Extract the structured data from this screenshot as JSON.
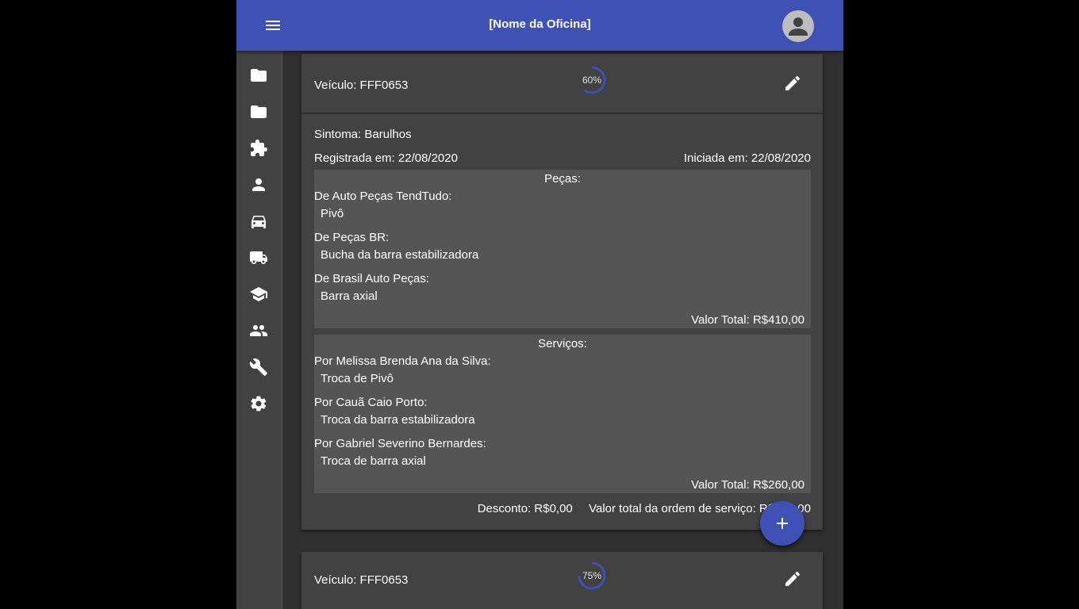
{
  "app": {
    "title": "[Nome da Oficina]",
    "accent": "#3f51b5"
  },
  "sidebar": {
    "items": [
      {
        "icon": "folder-icon"
      },
      {
        "icon": "folder-icon"
      },
      {
        "icon": "extension-icon"
      },
      {
        "icon": "person-icon"
      },
      {
        "icon": "car-icon"
      },
      {
        "icon": "truck-icon"
      },
      {
        "icon": "school-icon"
      },
      {
        "icon": "people-icon"
      },
      {
        "icon": "wrench-icon"
      },
      {
        "icon": "gear-icon"
      }
    ]
  },
  "orders": [
    {
      "vehicle": "Veículo: FFF0653",
      "progress_label": "60%",
      "progress": 0.6,
      "symptom": "Sintoma: Barulhos",
      "registered": "Registrada em: 22/08/2020",
      "started": "Iniciada em: 22/08/2020",
      "parts": {
        "header": "Peças:",
        "groups": [
          {
            "from": "De Auto Peças TendTudo:",
            "item": "Pivô"
          },
          {
            "from": "De Peças BR:",
            "item": "Bucha da barra estabilizadora"
          },
          {
            "from": "De Brasil Auto Peças:",
            "item": "Barra axial"
          }
        ],
        "total": "Valor Total: R$410,00"
      },
      "services": {
        "header": "Serviços:",
        "groups": [
          {
            "from": "Por Melissa Brenda Ana da Silva:",
            "item": "Troca de Pivô"
          },
          {
            "from": "Por Cauã Caio Porto:",
            "item": "Troca da barra estabilizadora"
          },
          {
            "from": "Por Gabriel Severino Bernardes:",
            "item": "Troca de barra axial"
          }
        ],
        "total": "Valor Total: R$260,00"
      },
      "discount": "Desconto: R$0,00",
      "order_total": "Valor total da ordem de serviço: R$670,00"
    },
    {
      "vehicle": "Veículo: FFF0653",
      "progress_label": "75%",
      "progress": 0.75
    }
  ],
  "fab_icon": "plus-icon"
}
